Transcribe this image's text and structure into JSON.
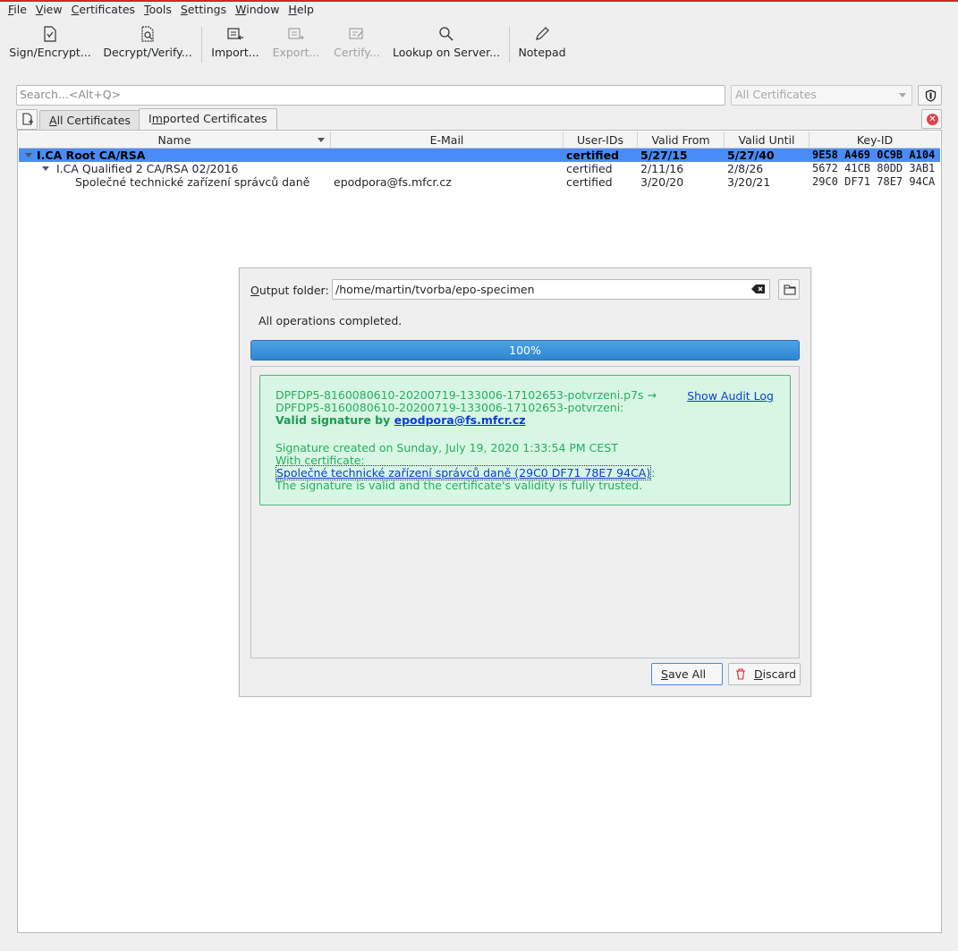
{
  "menubar": {
    "items": [
      {
        "name": "File",
        "u": "F",
        "rest": "ile"
      },
      {
        "name": "View",
        "u": "V",
        "rest": "iew"
      },
      {
        "name": "Certificates",
        "u": "C",
        "rest": "ertificates"
      },
      {
        "name": "Tools",
        "u": "T",
        "rest": "ools"
      },
      {
        "name": "Settings",
        "u": "S",
        "rest": "ettings"
      },
      {
        "name": "Window",
        "u": "W",
        "rest": "indow"
      },
      {
        "name": "Help",
        "u": "H",
        "rest": "elp"
      }
    ]
  },
  "toolbar": {
    "sign": "Sign/Encrypt...",
    "decrypt": "Decrypt/Verify...",
    "import": "Import...",
    "export": "Export...",
    "certify": "Certify...",
    "lookup": "Lookup on Server...",
    "notepad": "Notepad"
  },
  "search": {
    "placeholder": "Search...<Alt+Q>"
  },
  "filter": {
    "selected": "All Certificates"
  },
  "tabs": [
    {
      "u": "A",
      "rest": "ll Certificates"
    },
    {
      "pre": "I",
      "u": "m",
      "rest": "ported Certificates"
    }
  ],
  "table": {
    "columns": [
      "Name",
      "E-Mail",
      "User-IDs",
      "Valid From",
      "Valid Until",
      "Key-ID"
    ],
    "rows": [
      {
        "name": "I.CA Root CA/RSA",
        "email": "",
        "uids": "certified",
        "from": "5/27/15",
        "until": "5/27/40",
        "key": "9E58 A469 0C9B A104"
      },
      {
        "name": "I.CA Qualified 2 CA/RSA 02/2016",
        "email": "",
        "uids": "certified",
        "from": "2/11/16",
        "until": "2/8/26",
        "key": "5672 41CB 80DD 3AB1"
      },
      {
        "name": "Společné technické zařízení správců daně",
        "email": "epodpora@fs.mfcr.cz",
        "uids": "certified",
        "from": "3/20/20",
        "until": "3/20/21",
        "key": "29C0 DF71 78E7 94CA"
      }
    ]
  },
  "dialog": {
    "output_label_u": "O",
    "output_label_rest": "utput folder:",
    "output_value": "/home/martin/tvorba/epo-specimen",
    "status": "All operations completed.",
    "progress": {
      "value": 100,
      "text": "100%"
    },
    "result": {
      "line1": "DPFDP5-8160080610-20200719-133006-17102653-potvrzeni.p7s →",
      "line2": "DPFDP5-8160080610-20200719-133006-17102653-potvrzeni:",
      "valid_prefix": "Valid signature by ",
      "signer": "epodpora@fs.mfcr.cz",
      "created": "Signature created on Sunday, July 19, 2020 1:33:54 PM CEST",
      "with_cert": "With certificate:",
      "cert_link": "Společné technické zařízení správců daně (29C0 DF71 78E7 94CA)",
      "cert_suffix": ":",
      "trust": "The signature is valid and the certificate's validity is fully trusted.",
      "audit_log": "Show Audit Log"
    },
    "save_all_u": "S",
    "save_all_rest": "ave All",
    "discard_u": "D",
    "discard_rest": "iscard"
  },
  "colors": {
    "accent": "#4a8cf6",
    "success_bg": "#d7f6e3",
    "success_text": "#27ae60",
    "link": "#0a3dd4"
  }
}
